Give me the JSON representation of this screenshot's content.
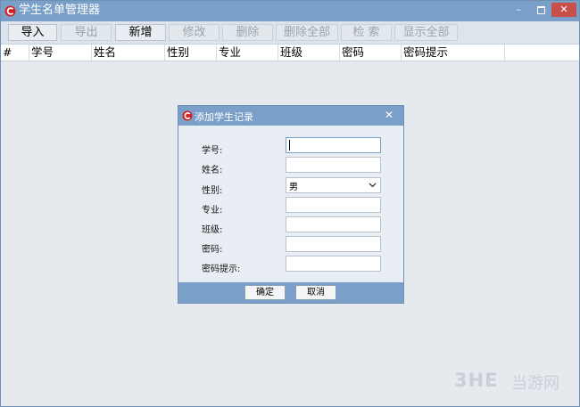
{
  "window": {
    "title": "学生名单管理器",
    "controls": {
      "minimize": "–",
      "close": "✕"
    }
  },
  "toolbar": {
    "buttons": [
      {
        "label": "导入",
        "enabled": true
      },
      {
        "label": "导出",
        "enabled": false
      },
      {
        "label": "新增",
        "enabled": true
      },
      {
        "label": "修改",
        "enabled": false
      },
      {
        "label": "删除",
        "enabled": false
      },
      {
        "label": "删除全部",
        "enabled": false
      },
      {
        "label": "检 索",
        "enabled": false
      },
      {
        "label": "显示全部",
        "enabled": false
      }
    ]
  },
  "table": {
    "columns": [
      "#",
      "学号",
      "姓名",
      "性别",
      "专业",
      "班级",
      "密码",
      "密码提示"
    ]
  },
  "dialog": {
    "title": "添加学生记录",
    "close": "✕",
    "fields": [
      {
        "label": "学号:",
        "value": ""
      },
      {
        "label": "姓名:",
        "value": ""
      },
      {
        "label": "性别:",
        "value": "男"
      },
      {
        "label": "专业:",
        "value": ""
      },
      {
        "label": "班级:",
        "value": ""
      },
      {
        "label": "密码:",
        "value": ""
      },
      {
        "label": "密码提示:",
        "value": ""
      }
    ],
    "ok_label": "确定",
    "cancel_label": "取消"
  },
  "watermark": {
    "logo": "3HE",
    "text": "当游网"
  },
  "colors": {
    "titlebar": "#7aa0c9",
    "close_button": "#c8504a",
    "background": "#dde4ec"
  }
}
